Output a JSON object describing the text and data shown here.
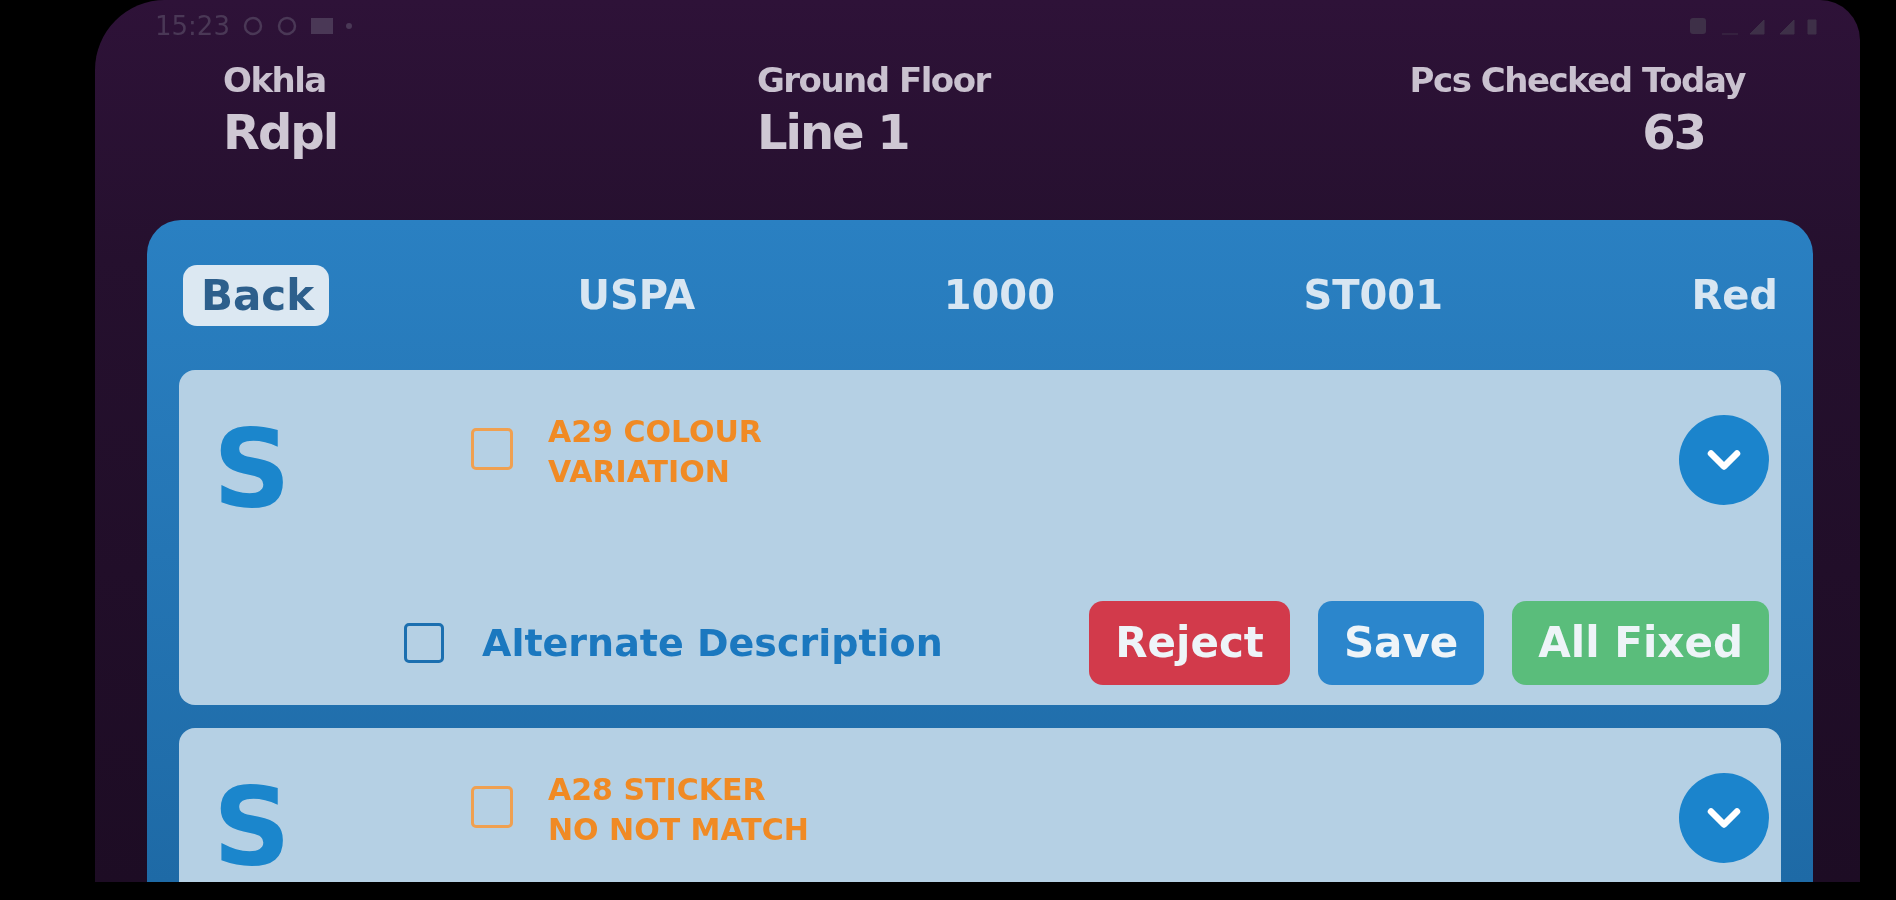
{
  "status_bar": {
    "time": "15:23"
  },
  "header": [
    {
      "caption": "Okhla",
      "value": "Rdpl"
    },
    {
      "caption": "Ground Floor",
      "value": "Line 1"
    },
    {
      "caption": "Pcs Checked Today",
      "value": "63"
    }
  ],
  "toolbar": {
    "back": "Back",
    "fields": [
      "USPA",
      "1000",
      "ST001",
      "Red"
    ]
  },
  "defects": [
    {
      "grade": "S",
      "checked": false,
      "label_lines": [
        "A29 COLOUR",
        "VARIATION"
      ],
      "alternate": {
        "label": "Alternate Description",
        "checked": false
      },
      "actions": [
        {
          "label": "Reject",
          "kind": "reject"
        },
        {
          "label": "Save",
          "kind": "save"
        },
        {
          "label": "All Fixed",
          "kind": "fixed"
        }
      ]
    },
    {
      "grade": "S",
      "checked": false,
      "label_lines": [
        "A28 STICKER",
        "NO NOT MATCH"
      ]
    }
  ]
}
